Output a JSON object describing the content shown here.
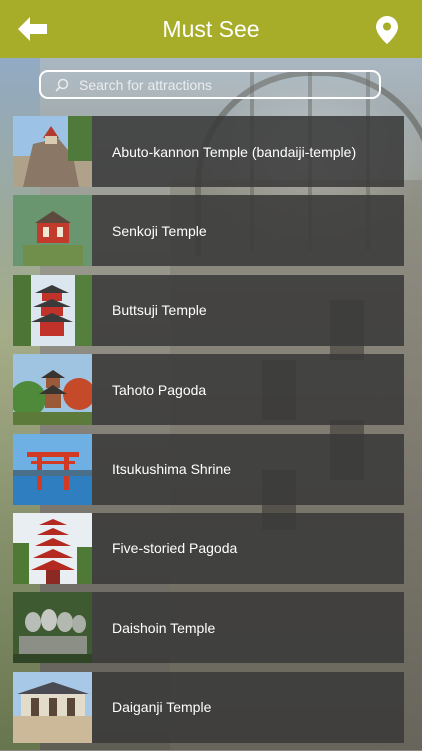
{
  "header": {
    "title": "Must See",
    "back_icon": "arrow-left-icon",
    "location_icon": "map-pin-icon",
    "color": "#a7ad28"
  },
  "search": {
    "placeholder": "Search for attractions"
  },
  "attractions": [
    {
      "name": "Abuto-kannon Temple (bandaiji-temple)",
      "thumb_icon": "rock-temple-photo"
    },
    {
      "name": "Senkoji Temple",
      "thumb_icon": "red-temple-photo"
    },
    {
      "name": "Buttsuji Temple",
      "thumb_icon": "red-pagoda-photo"
    },
    {
      "name": "Tahoto Pagoda",
      "thumb_icon": "pagoda-garden-photo"
    },
    {
      "name": "Itsukushima Shrine",
      "thumb_icon": "torii-gate-photo"
    },
    {
      "name": "Five-storied Pagoda",
      "thumb_icon": "five-storied-pagoda-photo"
    },
    {
      "name": "Daishoin Temple",
      "thumb_icon": "stone-statues-photo"
    },
    {
      "name": "Daiganji Temple",
      "thumb_icon": "temple-courtyard-photo"
    }
  ]
}
